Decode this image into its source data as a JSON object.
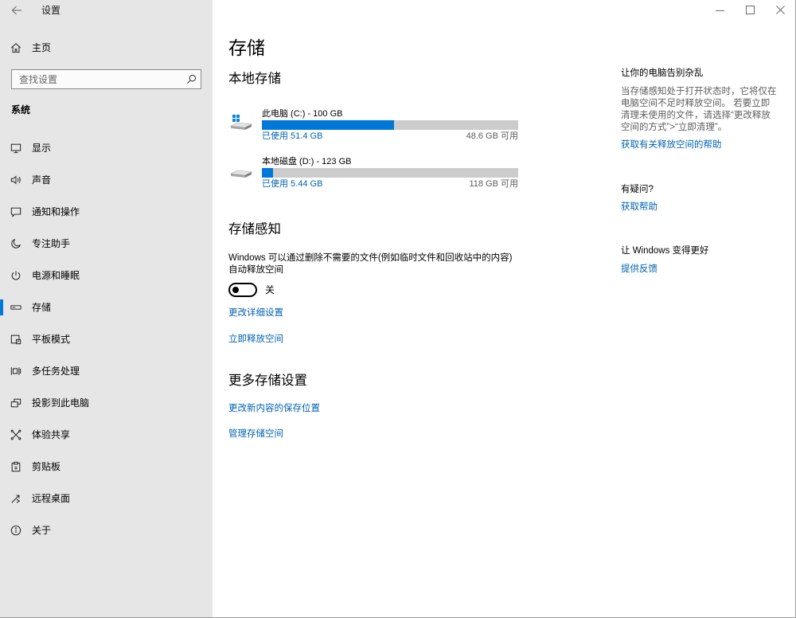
{
  "theme": {
    "accent": "#0078d7",
    "link": "#0063b1",
    "sidebar_bg": "#e6e6e6",
    "bar_track": "#cccccc",
    "text_muted": "#5d5d5d"
  },
  "title_bar": {
    "title": "设置",
    "back_icon": "back-arrow-icon",
    "window_controls": [
      "minimize-icon",
      "maximize-icon",
      "close-icon"
    ]
  },
  "sidebar": {
    "home": {
      "label": "主页",
      "icon": "home-icon"
    },
    "search": {
      "placeholder": "查找设置",
      "value": "",
      "icon": "search-icon"
    },
    "section_title": "系统",
    "items": [
      {
        "label": "显示",
        "icon": "display-icon"
      },
      {
        "label": "声音",
        "icon": "sound-icon"
      },
      {
        "label": "通知和操作",
        "icon": "notifications-icon"
      },
      {
        "label": "专注助手",
        "icon": "focus-assist-icon"
      },
      {
        "label": "电源和睡眠",
        "icon": "power-icon"
      },
      {
        "label": "存储",
        "icon": "storage-icon",
        "selected": true
      },
      {
        "label": "平板模式",
        "icon": "tablet-mode-icon"
      },
      {
        "label": "多任务处理",
        "icon": "multitasking-icon"
      },
      {
        "label": "投影到此电脑",
        "icon": "projecting-icon"
      },
      {
        "label": "体验共享",
        "icon": "shared-experiences-icon"
      },
      {
        "label": "剪贴板",
        "icon": "clipboard-icon"
      },
      {
        "label": "远程桌面",
        "icon": "remote-desktop-icon"
      },
      {
        "label": "关于",
        "icon": "about-icon"
      }
    ]
  },
  "main": {
    "page_title": "存储",
    "local_storage": {
      "heading": "本地存储",
      "drives": [
        {
          "name": "此电脑 (C:) - 100 GB",
          "used_label": "已使用 51.4 GB",
          "free_label": "48.6 GB 可用",
          "used_fraction": 0.514,
          "icon": "windows-drive-icon"
        },
        {
          "name": "本地磁盘 (D:) - 123 GB",
          "used_label": "已使用 5.44 GB",
          "free_label": "118 GB 可用",
          "used_fraction": 0.044,
          "icon": "drive-icon"
        }
      ]
    },
    "storage_sense": {
      "heading": "存储感知",
      "description_lines": [
        "Windows 可以通过删除不需要的文件(例如临时文件和回收站中的内容)",
        "自动释放空间"
      ],
      "toggle": {
        "on": false,
        "state_label": "关"
      },
      "links": [
        "更改详细设置",
        "立即释放空间"
      ]
    },
    "more_settings": {
      "heading": "更多存储设置",
      "links": [
        "更改新内容的保存位置",
        "管理存储空间"
      ]
    }
  },
  "aside": {
    "declutter": {
      "heading": "让你的电脑告别杂乱",
      "lines": [
        "当存储感知处于打开状态时，它将仅在",
        "电脑空间不足时释放空间。 若要立即",
        "清理未使用的文件，请选择“更改释放",
        "空间的方式”>“立即清理”。"
      ],
      "link": "获取有关释放空间的帮助"
    },
    "questions": {
      "heading": "有疑问?",
      "link": "获取帮助"
    },
    "feedback": {
      "heading": "让 Windows 变得更好",
      "link": "提供反馈"
    }
  }
}
